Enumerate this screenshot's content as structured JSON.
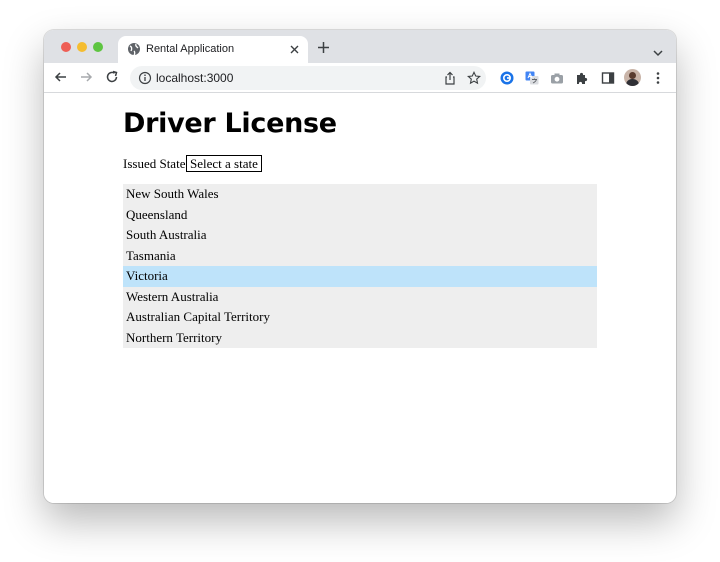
{
  "browser": {
    "tab_title": "Rental Application",
    "url": "localhost:3000"
  },
  "page": {
    "title": "Driver License",
    "issued_state_label": "Issued State:",
    "select_placeholder": "Select a state",
    "highlighted_index": 4,
    "options": [
      {
        "label": "New South Wales"
      },
      {
        "label": "Queensland"
      },
      {
        "label": "South Australia"
      },
      {
        "label": "Tasmania"
      },
      {
        "label": "Victoria"
      },
      {
        "label": "Western Australia"
      },
      {
        "label": "Australian Capital Territory"
      },
      {
        "label": "Northern Territory"
      }
    ]
  },
  "colors": {
    "highlight": "#bee3fa",
    "list_background": "#eeeeee",
    "tabstrip": "#dfe1e5"
  },
  "icons": {
    "tab": "globe-icon",
    "toolbar": [
      "back-arrow-icon",
      "forward-arrow-icon",
      "reload-icon",
      "info-icon",
      "share-icon",
      "star-icon"
    ],
    "extensions": [
      "google-extension-icon",
      "translate-extension-icon",
      "camera-extension-icon",
      "puzzle-extensions-icon",
      "side-panel-icon"
    ]
  }
}
